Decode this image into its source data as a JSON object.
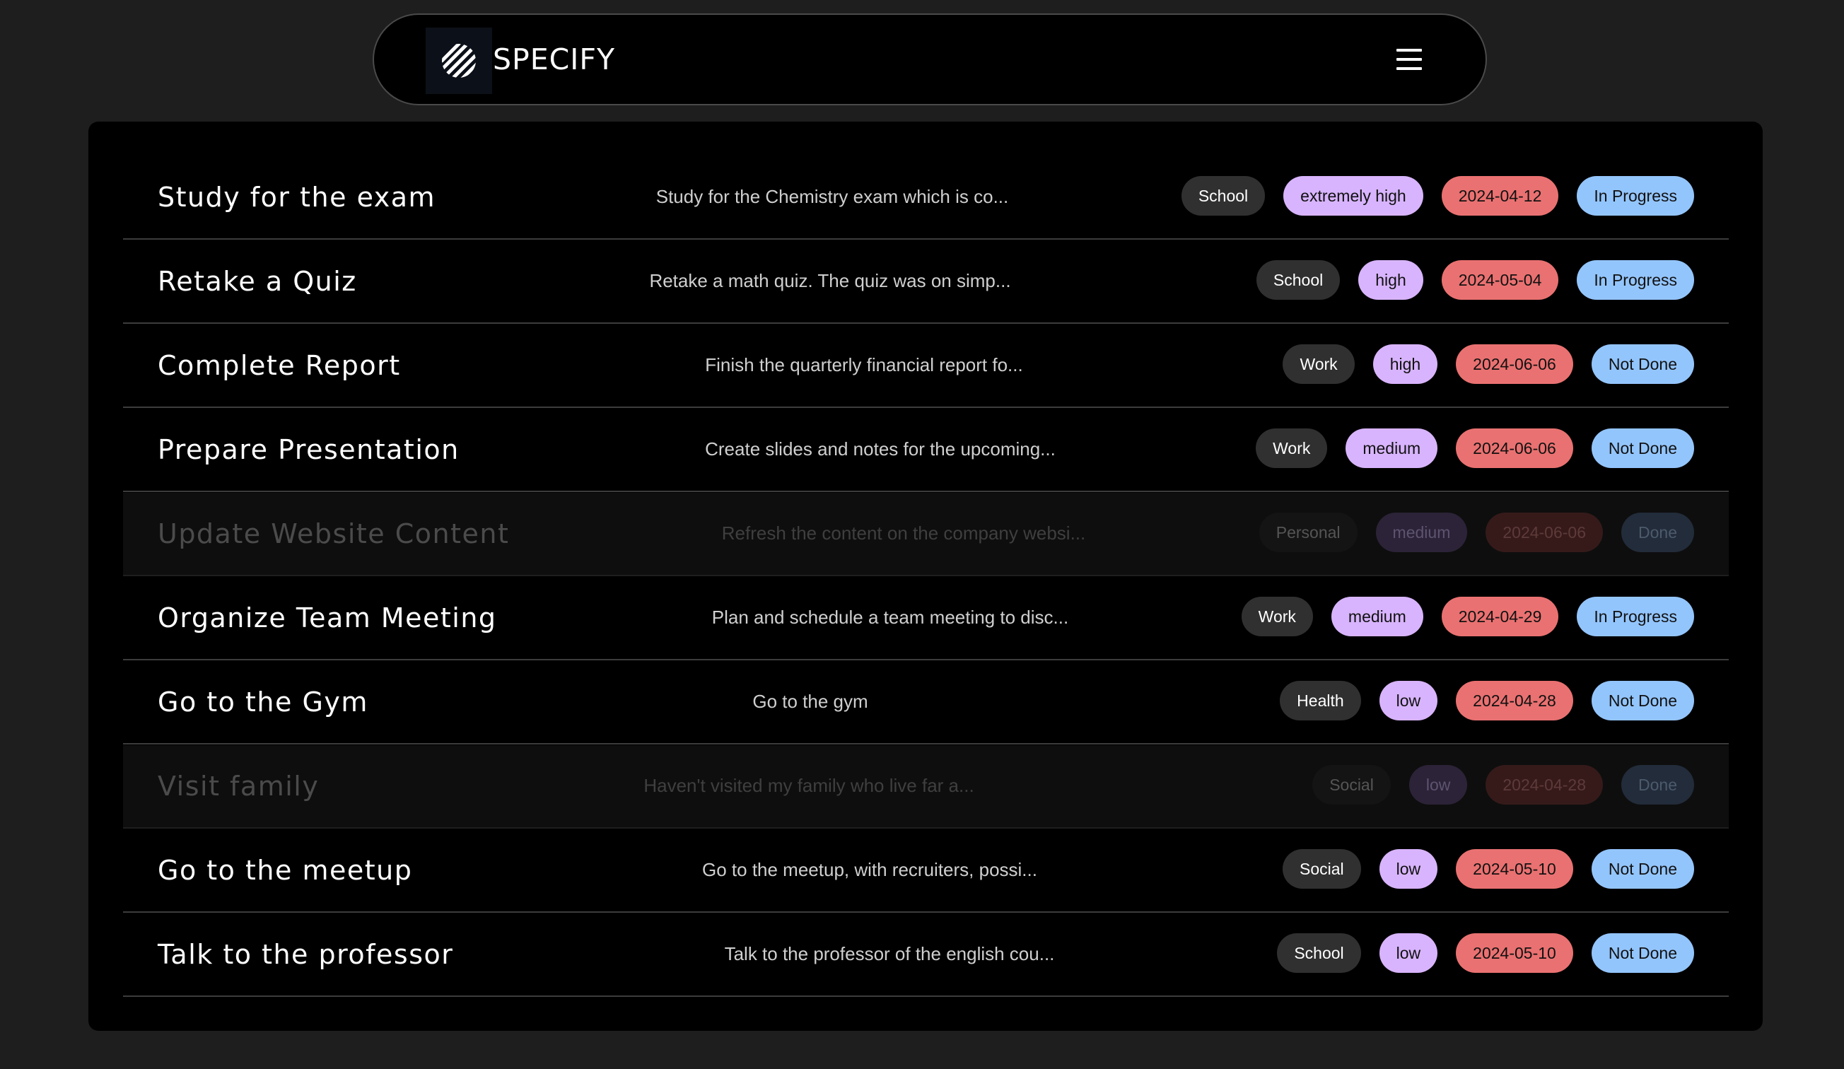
{
  "app": {
    "brand_name": "SPECIFY",
    "logo_icon": "striped-sphere-logo",
    "menu_icon": "hamburger-menu-icon"
  },
  "colors": {
    "page_background": "#1e1e1e",
    "panel_background": "#000000",
    "category_tag": "#303030",
    "priority_tag": "#d8b4fe",
    "date_tag": "#ea7171",
    "status_tag": "#93c5fd"
  },
  "tasks": [
    {
      "title": "Study for the exam",
      "description": "Study for the Chemistry exam which is co...",
      "category": "School",
      "priority": "extremely high",
      "due_date": "2024-04-12",
      "status": "In Progress",
      "done": false
    },
    {
      "title": "Retake a Quiz",
      "description": "Retake a math quiz. The quiz was on simp...",
      "category": "School",
      "priority": "high",
      "due_date": "2024-05-04",
      "status": "In Progress",
      "done": false
    },
    {
      "title": "Complete Report",
      "description": "Finish the quarterly financial report fo...",
      "category": "Work",
      "priority": "high",
      "due_date": "2024-06-06",
      "status": "Not Done",
      "done": false
    },
    {
      "title": "Prepare Presentation",
      "description": "Create slides and notes for the upcoming...",
      "category": "Work",
      "priority": "medium",
      "due_date": "2024-06-06",
      "status": "Not Done",
      "done": false
    },
    {
      "title": "Update Website Content",
      "description": "Refresh the content on the company websi...",
      "category": "Personal",
      "priority": "medium",
      "due_date": "2024-06-06",
      "status": "Done",
      "done": true
    },
    {
      "title": "Organize Team Meeting",
      "description": "Plan and schedule a team meeting to disc...",
      "category": "Work",
      "priority": "medium",
      "due_date": "2024-04-29",
      "status": "In Progress",
      "done": false
    },
    {
      "title": "Go to the Gym",
      "description": "Go to the gym",
      "category": "Health",
      "priority": "low",
      "due_date": "2024-04-28",
      "status": "Not Done",
      "done": false
    },
    {
      "title": "Visit family",
      "description": "Haven't visited my family who live far a...",
      "category": "Social",
      "priority": "low",
      "due_date": "2024-04-28",
      "status": "Done",
      "done": true
    },
    {
      "title": "Go to the meetup",
      "description": "Go to the meetup, with recruiters, possi...",
      "category": "Social",
      "priority": "low",
      "due_date": "2024-05-10",
      "status": "Not Done",
      "done": false
    },
    {
      "title": "Talk to the professor",
      "description": "Talk to the professor of the english cou...",
      "category": "School",
      "priority": "low",
      "due_date": "2024-05-10",
      "status": "Not Done",
      "done": false
    }
  ]
}
